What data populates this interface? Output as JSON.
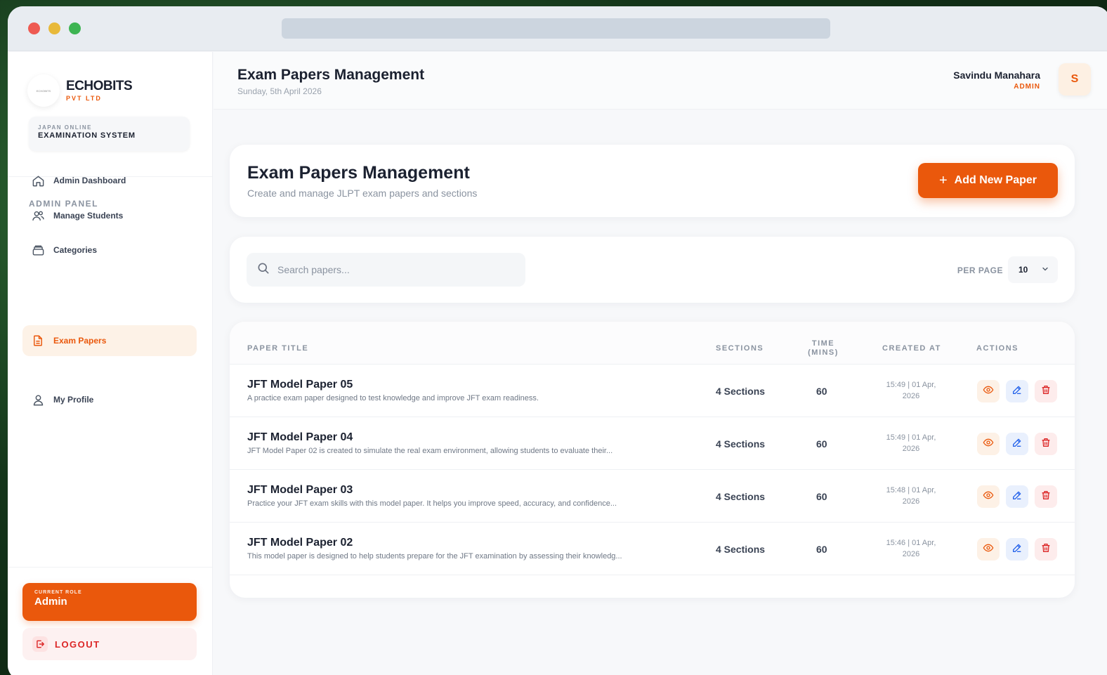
{
  "brand": {
    "name": "ECHOBITS",
    "sub": "PVT LTD",
    "logo_text": "ECHOBITS"
  },
  "system": {
    "small": "JAPAN ONLINE",
    "big": "EXAMINATION SYSTEM"
  },
  "sidebar": {
    "panel_label": "ADMIN PANEL",
    "items": [
      {
        "label": "Admin Dashboard",
        "icon": "home-icon"
      },
      {
        "label": "Manage Students",
        "icon": "users-icon"
      },
      {
        "label": "Categories",
        "icon": "layers-icon"
      },
      {
        "label": "Exam Papers",
        "icon": "document-icon",
        "active": true
      },
      {
        "label": "My Profile",
        "icon": "user-icon"
      }
    ],
    "role_small": "CURRENT ROLE",
    "role_big": "Admin",
    "logout": "LOGOUT"
  },
  "header": {
    "title": "Exam Papers Management",
    "date": "Sunday, 5th April 2026",
    "user_name": "Savindu Manahara",
    "user_role": "ADMIN",
    "avatar": "S"
  },
  "main": {
    "title": "Exam Papers Management",
    "subtitle": "Create and manage JLPT exam papers and sections",
    "add_button": "Add New Paper",
    "search_placeholder": "Search papers...",
    "per_page_label": "PER PAGE",
    "per_page_value": "10",
    "columns": [
      "PAPER TITLE",
      "SECTIONS",
      "TIME",
      "(MINS)",
      "CREATED AT",
      "ACTIONS"
    ],
    "rows": [
      {
        "title": "JFT Model Paper 05",
        "desc": "A practice exam paper designed to test knowledge and improve JFT exam readiness.",
        "sections": "4 Sections",
        "time": "60",
        "created_1": "15:49 | 01 Apr,",
        "created_2": "2026"
      },
      {
        "title": "JFT Model Paper 04",
        "desc": "JFT Model Paper 02 is created to simulate the real exam environment, allowing students to evaluate their...",
        "sections": "4 Sections",
        "time": "60",
        "created_1": "15:49 | 01 Apr,",
        "created_2": "2026"
      },
      {
        "title": "JFT Model Paper 03",
        "desc": "Practice your JFT exam skills with this model paper. It helps you improve speed, accuracy, and confidence...",
        "sections": "4 Sections",
        "time": "60",
        "created_1": "15:48 | 01 Apr,",
        "created_2": "2026"
      },
      {
        "title": "JFT Model Paper 02",
        "desc": "This model paper is designed to help students prepare for the JFT examination by assessing their knowledg...",
        "sections": "4 Sections",
        "time": "60",
        "created_1": "15:46 | 01 Apr,",
        "created_2": "2026"
      }
    ]
  },
  "colors": {
    "accent": "#ea580c",
    "danger": "#dc2626",
    "edit": "#2563eb"
  }
}
